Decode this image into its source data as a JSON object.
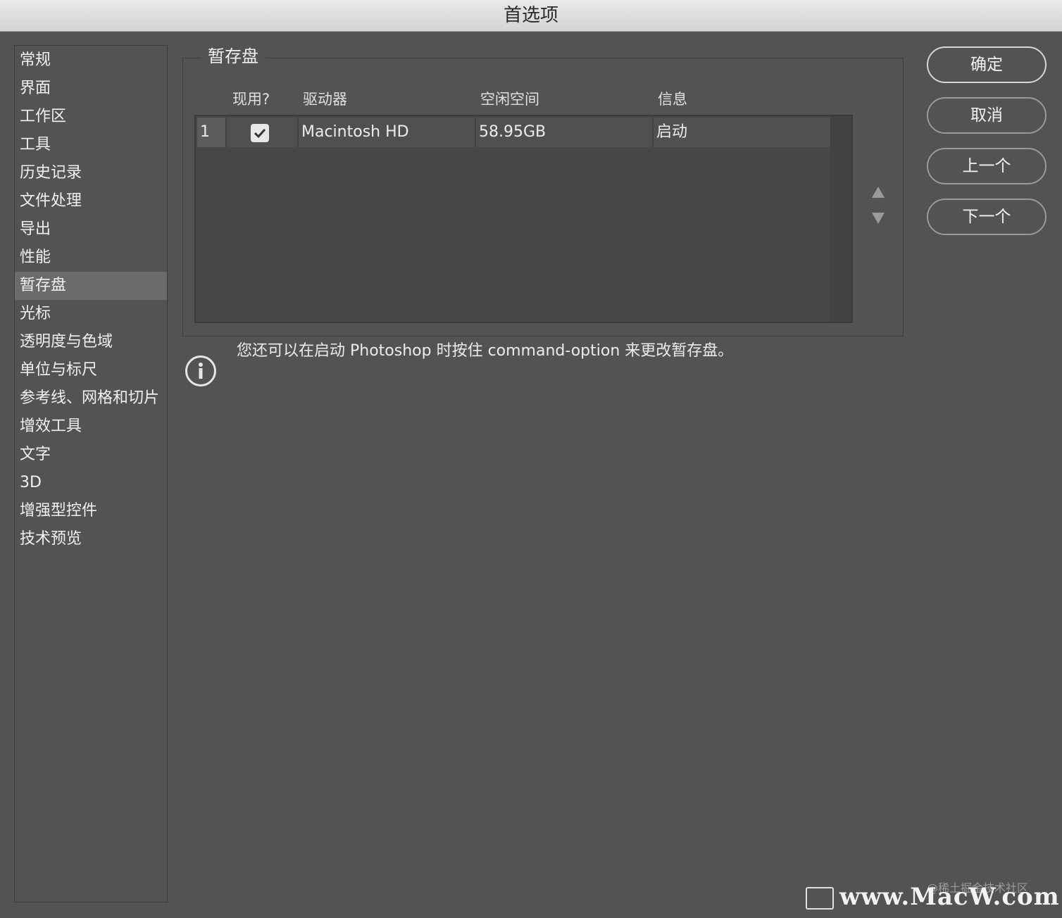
{
  "window": {
    "title": "首选项"
  },
  "sidebar": {
    "items": [
      {
        "label": "常规"
      },
      {
        "label": "界面"
      },
      {
        "label": "工作区"
      },
      {
        "label": "工具"
      },
      {
        "label": "历史记录"
      },
      {
        "label": "文件处理"
      },
      {
        "label": "导出"
      },
      {
        "label": "性能"
      },
      {
        "label": "暂存盘",
        "selected": true
      },
      {
        "label": "光标"
      },
      {
        "label": "透明度与色域"
      },
      {
        "label": "单位与标尺"
      },
      {
        "label": "参考线、网格和切片"
      },
      {
        "label": "增效工具"
      },
      {
        "label": "文字"
      },
      {
        "label": "3D"
      },
      {
        "label": "增强型控件"
      },
      {
        "label": "技术预览"
      }
    ]
  },
  "panel": {
    "title": "暂存盘",
    "columns": [
      "现用?",
      "驱动器",
      "空闲空间",
      "信息"
    ],
    "rows": [
      {
        "index": "1",
        "active": true,
        "drive": "Macintosh HD",
        "free": "58.95GB",
        "info": "启动"
      }
    ],
    "hint": "您还可以在启动 Photoshop 时按住 command-option 来更改暂存盘。"
  },
  "buttons": {
    "ok": "确定",
    "cancel": "取消",
    "prev": "上一个",
    "next": "下一个"
  },
  "watermark": {
    "small": "@稀土掘金技术社区",
    "large": "www.MacW.com"
  },
  "icons": {
    "check": "checkmark-icon",
    "info": "info-icon",
    "up": "arrow-up-icon",
    "down": "arrow-down-icon"
  }
}
